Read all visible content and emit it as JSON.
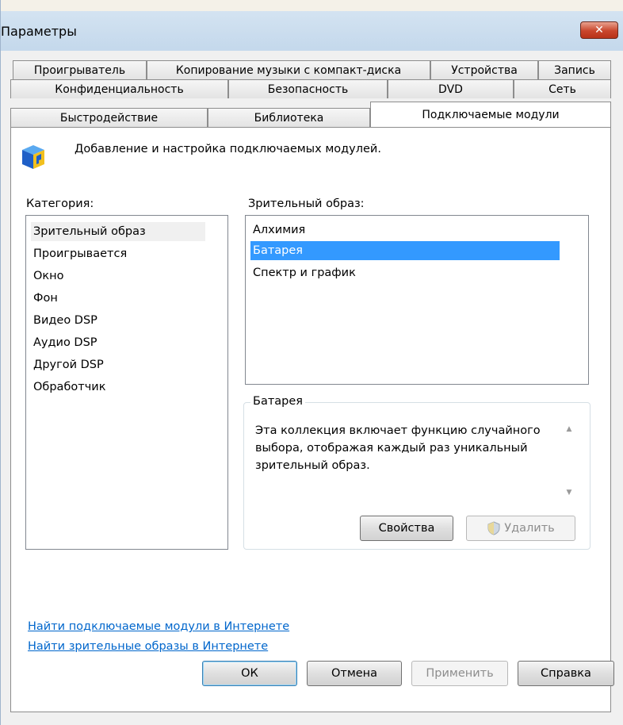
{
  "window": {
    "title": "Параметры",
    "close_label": "✕"
  },
  "tabs": {
    "row1": [
      "Проигрыватель",
      "Копирование музыки с компакт-диска",
      "Устройства",
      "Запись"
    ],
    "row2": [
      "Конфиденциальность",
      "Безопасность",
      "DVD",
      "Сеть"
    ],
    "row3": [
      "Быстродействие",
      "Библиотека",
      "Подключаемые модули"
    ],
    "active": "Подключаемые модули"
  },
  "plugins": {
    "header": "Добавление и настройка подключаемых модулей.",
    "category_label": "Категория:",
    "categories": [
      "Зрительный образ",
      "Проигрывается",
      "Окно",
      "Фон",
      "Видео DSP",
      "Аудио DSP",
      "Другой DSP",
      "Обработчик"
    ],
    "selected_category": "Зрительный образ",
    "visual_label": "Зрительный образ:",
    "visuals": [
      "Алхимия",
      "Батарея",
      "Спектр и график"
    ],
    "selected_visual": "Батарея",
    "group_title": "Батарея",
    "description": "Эта коллекция включает функцию случайного выбора, отображая каждый раз уникальный зрительный образ.",
    "properties_button": "Свойства",
    "delete_button": "Удалить",
    "link_plugins": "Найти подключаемые модули в Интернете",
    "link_visuals": "Найти зрительные образы в Интернете"
  },
  "footer": {
    "ok": "ОК",
    "cancel": "Отмена",
    "apply": "Применить",
    "help": "Справка"
  },
  "colors": {
    "selection": "#3399ff",
    "link": "#0066cc",
    "close_button": "#c9462c"
  }
}
